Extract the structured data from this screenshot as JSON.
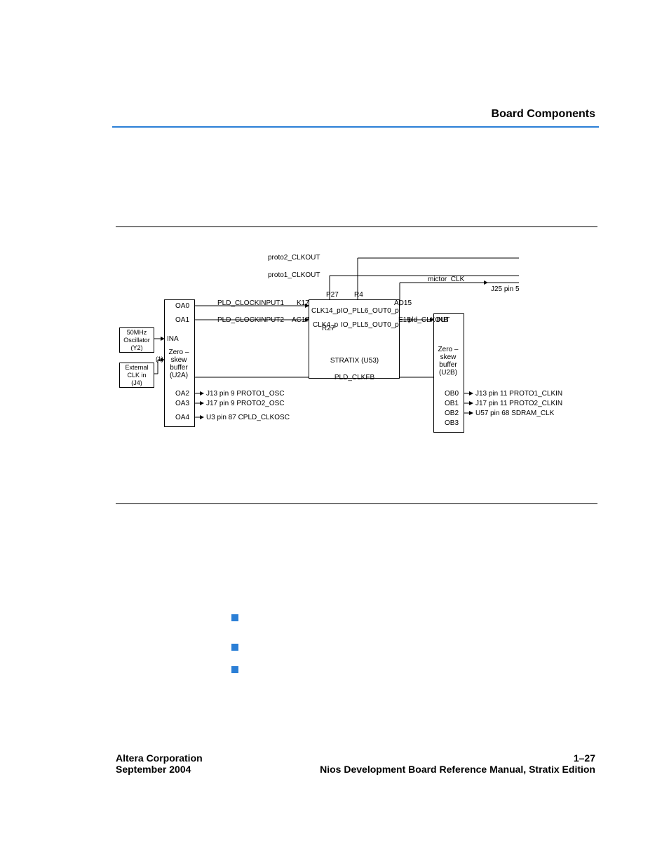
{
  "header": {
    "title": "Board Components"
  },
  "diagram": {
    "osc": "50MHz\nOscillator\n(Y2)",
    "ext": "External\nCLK in\n(J4)",
    "u2a": "Zero –\nskew\nbuffer\n(U2A)",
    "u2b": "Zero –\nskew\nbuffer\n(U2B)",
    "u53": "STRATIX (U53)",
    "ina": "INA",
    "inb": "INB",
    "oa0": "OA0",
    "oa1": "OA1",
    "oa2": "OA2",
    "oa3": "OA3",
    "oa4": "OA4",
    "ob0": "OB0",
    "ob1": "OB1",
    "ob2": "OB2",
    "ob3": "OB3",
    "pld_clockinput1": "PLD_CLOCKINPUT1",
    "pld_clockinput2": "PLD_CLOCKINPUT2",
    "k17": "K17",
    "ac17": "AC17",
    "r27": "R27",
    "p27": "P27",
    "r4": "R4",
    "ad15": "AD15",
    "e15": "E15",
    "clk14p": "CLK14_p",
    "clk4p": "CLK4_p",
    "io_pll6": "IO_PLL6_OUT0_p",
    "io_pll5": "IO_PLL5_OUT0_p",
    "pld_clkout": "pld_CLKOUT",
    "pld_clkfb": "PLD_CLKFB",
    "proto1_clkout": "proto1_CLKOUT",
    "proto2_clkout": "proto2_CLKOUT",
    "mictor_clk": "mictor_CLK",
    "j25pin5": "J25  pin 5",
    "note1": "(1)",
    "oa2_dest": "J13  pin 9  PROTO1_OSC",
    "oa3_dest": "J17  pin 9  PROTO2_OSC",
    "oa4_dest": "U3  pin 87  CPLD_CLKOSC",
    "ob0_dest": "J13  pin 11  PROTO1_CLKIN",
    "ob1_dest": "J17  pin 11  PROTO2_CLKIN",
    "ob2_dest": "U57  pin 68  SDRAM_CLK"
  },
  "bullets": {
    "b1": "",
    "b2": "",
    "b3": ""
  },
  "footer": {
    "corp": "Altera Corporation",
    "date": "September 2004",
    "pageno": "1–27",
    "manual": "Nios Development Board Reference Manual, Stratix Edition"
  }
}
